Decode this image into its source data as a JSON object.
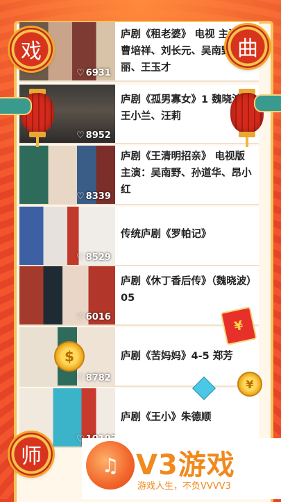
{
  "decor": {
    "medallions": [
      "戏",
      "曲",
      "师"
    ],
    "envelope_symbol": "¥",
    "coin_symbols": [
      "$",
      "¥"
    ]
  },
  "videos": [
    {
      "title": "庐剧《租老婆》 电视 主演：曹培祥、刘长元、吴南野、张丽、王玉才",
      "likes": "6931",
      "heart": "♡"
    },
    {
      "title": "庐剧《孤男寡女》1 魏晓波、王小兰、汪莉",
      "likes": "8952",
      "heart": "♡"
    },
    {
      "title": "庐剧《王清明招亲》 电视版 主演：吴南野、孙道华、昂小红",
      "likes": "8339",
      "heart": "♡"
    },
    {
      "title": "传统庐剧《罗帕记》",
      "likes": "8529",
      "heart": "♡"
    },
    {
      "title": "庐剧《休丁香后传》（魏晓波）05",
      "likes": "6016",
      "heart": "♡"
    },
    {
      "title": "庐剧《苦妈妈》4-5 郑芳",
      "likes": "8782",
      "heart": "♡"
    },
    {
      "title": "庐剧《王小》朱德顺",
      "likes": "10193",
      "heart": "♡"
    }
  ],
  "watermark": {
    "brand": "V3游戏",
    "slogan": "游戏人生，不负VVVV3"
  }
}
